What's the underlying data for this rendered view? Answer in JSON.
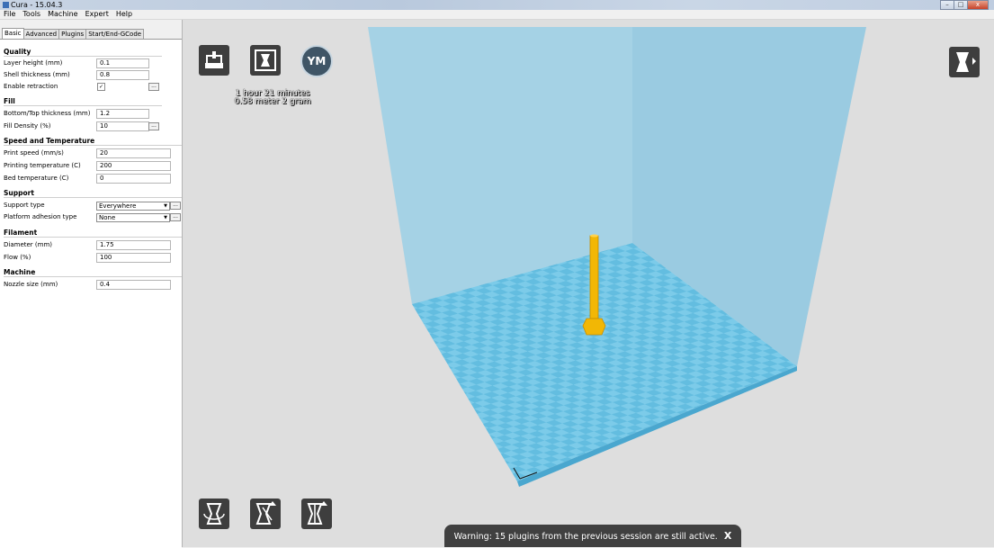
{
  "window": {
    "title": "Cura - 15.04.3",
    "minimize": "–",
    "maximize": "□",
    "close": "x"
  },
  "menu": [
    "File",
    "Tools",
    "Machine",
    "Expert",
    "Help"
  ],
  "tabs": [
    "Basic",
    "Advanced",
    "Plugins",
    "Start/End-GCode"
  ],
  "sections": {
    "quality": {
      "title": "Quality",
      "layer_height": {
        "label": "Layer height (mm)",
        "value": "0.1"
      },
      "shell_thickness": {
        "label": "Shell thickness (mm)",
        "value": "0.8"
      },
      "enable_retraction": {
        "label": "Enable retraction",
        "checked": "✓"
      }
    },
    "fill": {
      "title": "Fill",
      "bottom_top": {
        "label": "Bottom/Top thickness (mm)",
        "value": "1.2"
      },
      "fill_density": {
        "label": "Fill Density (%)",
        "value": "10"
      }
    },
    "speed": {
      "title": "Speed and Temperature",
      "print_speed": {
        "label": "Print speed (mm/s)",
        "value": "20"
      },
      "print_temp": {
        "label": "Printing temperature (C)",
        "value": "200"
      },
      "bed_temp": {
        "label": "Bed temperature (C)",
        "value": "0"
      }
    },
    "support": {
      "title": "Support",
      "support_type": {
        "label": "Support type",
        "value": "Everywhere"
      },
      "platform_adhesion": {
        "label": "Platform adhesion type",
        "value": "None"
      }
    },
    "filament": {
      "title": "Filament",
      "diameter": {
        "label": "Diameter (mm)",
        "value": "1.75"
      },
      "flow": {
        "label": "Flow (%)",
        "value": "100"
      }
    },
    "machine": {
      "title": "Machine",
      "nozzle": {
        "label": "Nozzle size (mm)",
        "value": "0.4"
      }
    }
  },
  "dots_label": "...",
  "viewport": {
    "user_badge": "YM",
    "print_time": "1 hour 21 minutes",
    "print_material": "0.58 meter 2 gram",
    "warning": "Warning: 15 plugins from the previous session are still active.",
    "warning_close": "X"
  },
  "colors": {
    "build_volume": "#9fd0e6",
    "bed": "#63bde0",
    "model": "#f2b705",
    "toolbar_button": "#3e3e3e"
  },
  "icons": [
    "load-icon",
    "save-to-sd-icon",
    "user-avatar",
    "view-mode-icon",
    "rotate-icon",
    "scale-icon",
    "mirror-icon"
  ]
}
